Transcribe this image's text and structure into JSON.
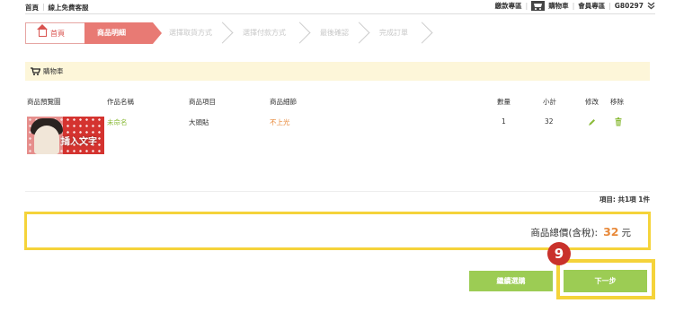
{
  "top_nav": {
    "left": [
      "首頁",
      "線上免費客服"
    ],
    "right": [
      "繳款專區",
      "購物車",
      "會員專區",
      "G80297"
    ]
  },
  "steps": [
    "首頁",
    "商品明細",
    "選擇取貨方式",
    "選擇付款方式",
    "最後確認",
    "完成訂單"
  ],
  "cart_title": "購物車",
  "table": {
    "headers": [
      "商品預覽圖",
      "作品名稱",
      "商品項目",
      "商品細節",
      "數量",
      "小計",
      "修改",
      "移除"
    ],
    "rows": [
      {
        "preview_text": "插入文字",
        "name": "未命名",
        "item": "大頭貼",
        "detail": "不上光",
        "qty": "1",
        "subtotal": "32"
      }
    ]
  },
  "summary": "項目: 共1項 1件",
  "total": {
    "label": "商品總價(含稅):",
    "amount": "32",
    "unit": "元"
  },
  "buttons": {
    "continue": "繼續選購",
    "next": "下一步"
  },
  "annotation_badge": "9",
  "colors": {
    "accent_green": "#9ccc54",
    "highlight_yellow": "#f5d33a",
    "step_active": "#e87a74",
    "badge_red": "#c9312b",
    "price_orange": "#e8893a"
  },
  "icons": [
    "cart-icon",
    "house-icon",
    "pencil-icon",
    "trash-icon",
    "double-chevron-down-icon"
  ]
}
